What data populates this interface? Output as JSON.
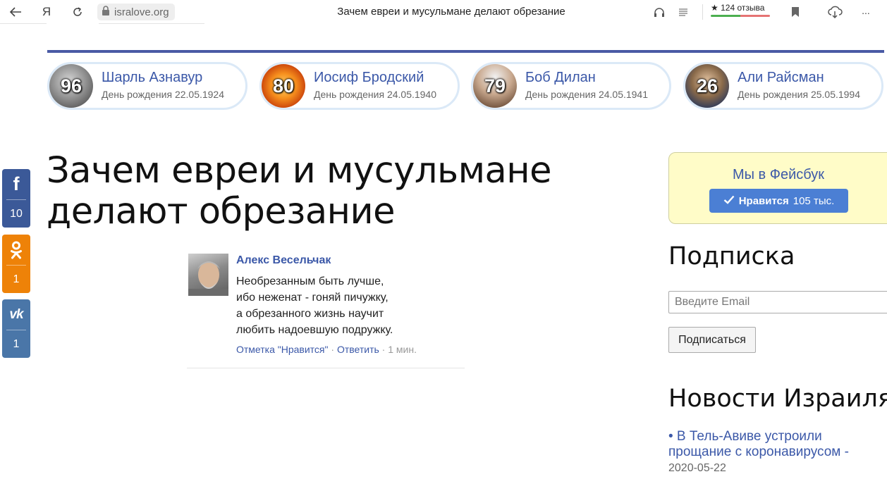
{
  "browser": {
    "url": "isralove.org",
    "tab_title": "Зачем евреи и мусульмане делают обрезание",
    "yandex_label": "Я",
    "reviews_label": "★ 124 отзыва",
    "more_label": "..."
  },
  "birthdays": [
    {
      "age": "96",
      "name": "Шарль Азнавур",
      "date": "День рождения 22.05.1924"
    },
    {
      "age": "80",
      "name": "Иосиф Бродский",
      "date": "День рождения 24.05.1940"
    },
    {
      "age": "79",
      "name": "Боб Дилан",
      "date": "День рождения 24.05.1941"
    },
    {
      "age": "26",
      "name": "Али Райсман",
      "date": "День рождения 25.05.1994"
    }
  ],
  "share": {
    "facebook": {
      "icon": "f",
      "count": "10"
    },
    "odnoklassniki": {
      "count": "1"
    },
    "vk": {
      "icon": "vk",
      "count": "1"
    }
  },
  "article": {
    "title": "Зачем евреи и мусульмане делают обрезание"
  },
  "comment": {
    "author": "Алекс Весельчак",
    "lines": [
      "Необрезанным быть лучше,",
      "ибо неженат - гоняй пичужку,",
      "а обрезанного жизнь научит",
      "любить надоевшую подружку."
    ],
    "like_label": "Отметка \"Нравится\"",
    "reply_label": "Ответить",
    "time": "1 мин.",
    "separator": "·"
  },
  "sidebar": {
    "fb_title": "Мы в Фейсбук",
    "fb_like_bold": "Нравится",
    "fb_like_count": "105 тыс.",
    "subscribe_heading": "Подписка",
    "email_placeholder": "Введите Email",
    "subscribe_button": "Подписаться",
    "news_heading": "Новости Израиля",
    "news": [
      {
        "title": "• В Тель-Авиве устроили прощание с коронавирусом -",
        "date": "2020-05-22"
      }
    ]
  },
  "colors": {
    "accent_blue": "#3b58a8",
    "header_rule": "#4a5aa5",
    "facebook": "#3b5998",
    "odnoklassniki": "#ee8208",
    "vk": "#4a76a8",
    "fb_box_bg": "#fffcc8"
  }
}
